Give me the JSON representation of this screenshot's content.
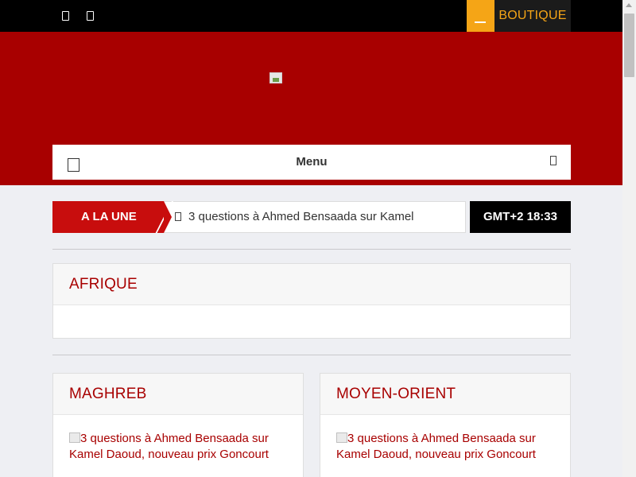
{
  "topbar": {
    "social_icons": [
      "social-icon-1",
      "social-icon-2"
    ],
    "shop_label": "BOUTIQUE",
    "shop_accent": "#f5a516"
  },
  "header": {
    "background": "#a80000",
    "logo": "logo-image"
  },
  "nav": {
    "menu_label": "Menu"
  },
  "ticker": {
    "tag": "A LA UNE",
    "headline": "3 questions à Ahmed Bensaada sur Kamel",
    "clock": "GMT+2 18:33"
  },
  "sections": {
    "afrique": {
      "title": "AFRIQUE"
    },
    "maghreb": {
      "title": "MAGHREB",
      "article": "3 questions à Ahmed Bensaada sur Kamel Daoud, nouveau prix Goncourt"
    },
    "moyen_orient": {
      "title": "MOYEN-ORIENT",
      "article": "3 questions à Ahmed Bensaada sur Kamel Daoud, nouveau prix Goncourt"
    }
  }
}
